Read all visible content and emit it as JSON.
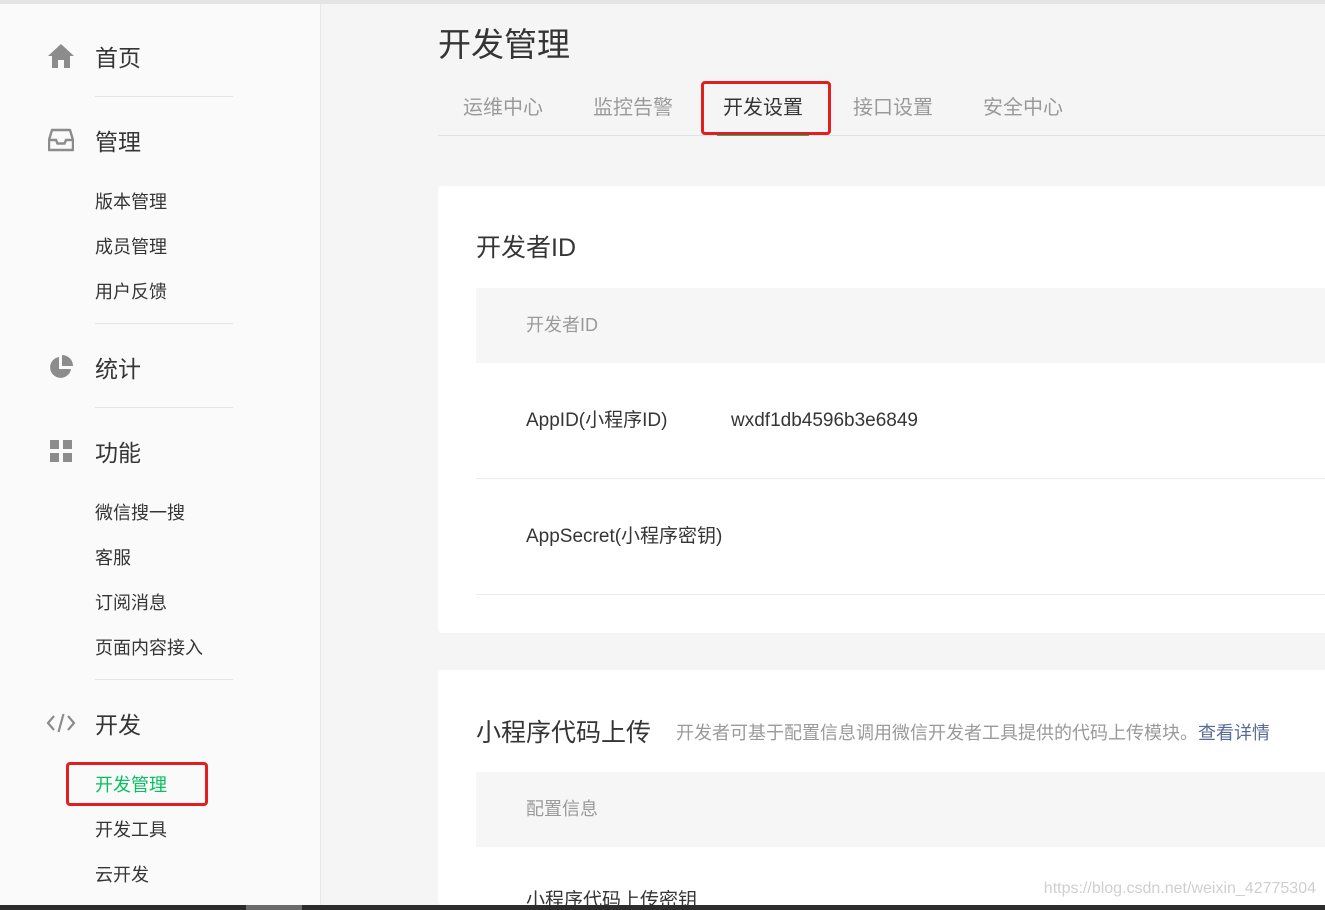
{
  "sidebar": {
    "groups": [
      {
        "label": "首页",
        "icon": "home-icon"
      },
      {
        "label": "管理",
        "icon": "inbox-icon",
        "items": [
          "版本管理",
          "成员管理",
          "用户反馈"
        ]
      },
      {
        "label": "统计",
        "icon": "pie-chart-icon"
      },
      {
        "label": "功能",
        "icon": "grid-icon",
        "items": [
          "微信搜一搜",
          "客服",
          "订阅消息",
          "页面内容接入"
        ]
      },
      {
        "label": "开发",
        "icon": "code-icon",
        "items": [
          "开发管理",
          "开发工具",
          "云开发"
        ],
        "active_item": "开发管理"
      }
    ]
  },
  "main": {
    "title": "开发管理",
    "tabs": [
      "运维中心",
      "监控告警",
      "开发设置",
      "接口设置",
      "安全中心"
    ],
    "active_tab": "开发设置",
    "developer_id": {
      "title": "开发者ID",
      "header": "开发者ID",
      "rows": [
        {
          "key": "AppID(小程序ID)",
          "value": "wxdf1db4596b3e6849"
        },
        {
          "key": "AppSecret(小程序密钥)",
          "value": ""
        }
      ]
    },
    "code_upload": {
      "title": "小程序代码上传",
      "description": "开发者可基于配置信息调用微信开发者工具提供的代码上传模块。",
      "link": "查看详情",
      "header": "配置信息",
      "rows": [
        {
          "key": "小程序代码上传密钥",
          "value": ""
        }
      ]
    }
  },
  "watermark": "https://blog.csdn.net/weixin_42775304",
  "colors": {
    "accent": "#07c160",
    "link": "#576b95",
    "highlight_box": "#e02020"
  }
}
